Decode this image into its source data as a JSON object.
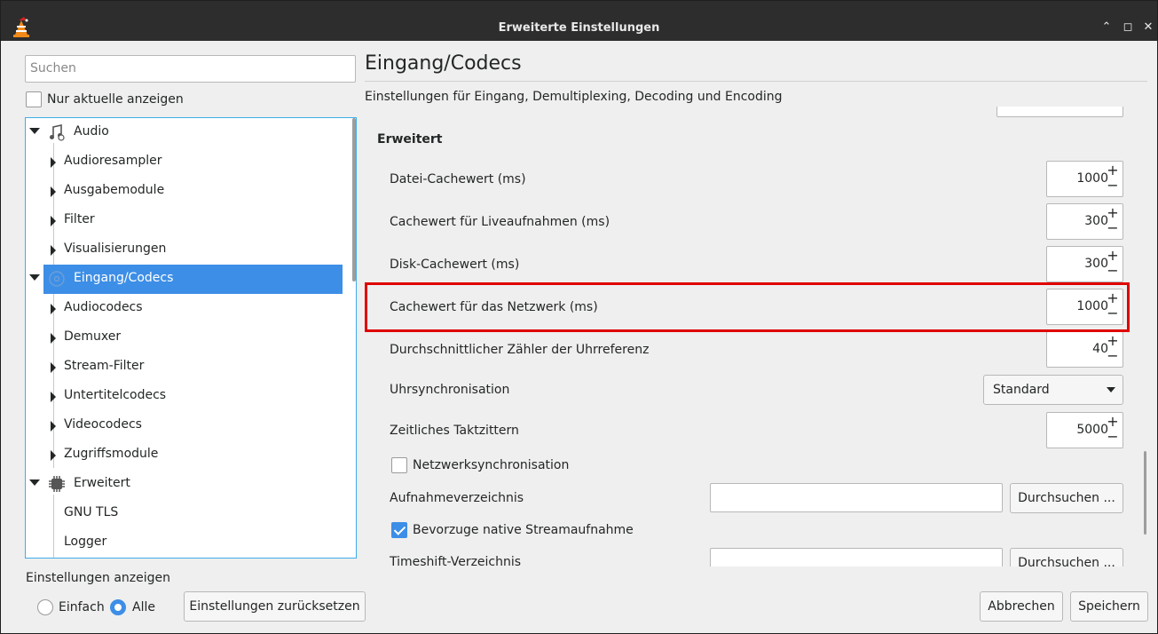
{
  "window": {
    "title": "Erweiterte Einstellungen"
  },
  "left": {
    "search_placeholder": "Suchen",
    "only_current_label": "Nur aktuelle anzeigen",
    "tree": [
      {
        "label": "Audio",
        "level": 0,
        "expanded": true,
        "icon": "music-settings-icon"
      },
      {
        "label": "Audioresampler",
        "level": 1
      },
      {
        "label": "Ausgabemodule",
        "level": 1
      },
      {
        "label": "Filter",
        "level": 1
      },
      {
        "label": "Visualisierungen",
        "level": 1
      },
      {
        "label": "Eingang/Codecs",
        "level": 0,
        "expanded": true,
        "selected": true,
        "icon": "disc-icon"
      },
      {
        "label": "Audiocodecs",
        "level": 1
      },
      {
        "label": "Demuxer",
        "level": 1
      },
      {
        "label": "Stream-Filter",
        "level": 1
      },
      {
        "label": "Untertitelcodecs",
        "level": 1
      },
      {
        "label": "Videocodecs",
        "level": 1
      },
      {
        "label": "Zugriffsmodule",
        "level": 1
      },
      {
        "label": "Erweitert",
        "level": 0,
        "expanded": true,
        "icon": "chip-icon"
      },
      {
        "label": "GNU TLS",
        "level": 1,
        "leaf": true
      },
      {
        "label": "Logger",
        "level": 1,
        "leaf": true
      }
    ]
  },
  "right": {
    "title": "Eingang/Codecs",
    "subtitle": "Einstellungen für Eingang, Demultiplexing, Decoding und Encoding",
    "section": "Erweitert",
    "file_cache_label": "Datei-Cachewert (ms)",
    "file_cache_value": "1000",
    "live_cache_label": "Cachewert für Liveaufnahmen (ms)",
    "live_cache_value": "300",
    "disc_cache_label": "Disk-Cachewert (ms)",
    "disc_cache_value": "300",
    "network_cache_label": "Cachewert für das Netzwerk (ms)",
    "network_cache_value": "1000",
    "clock_ref_label": "Durchschnittlicher Zähler der Uhrreferenz",
    "clock_ref_value": "40",
    "clock_sync_label": "Uhrsynchronisation",
    "clock_sync_value": "Standard",
    "clock_jitter_label": "Zeitliches Taktzittern",
    "clock_jitter_value": "5000",
    "network_sync_label": "Netzwerksynchronisation",
    "record_dir_label": "Aufnahmeverzeichnis",
    "browse_label": "Durchsuchen ...",
    "native_record_label": "Bevorzuge native Streamaufnahme",
    "timeshift_label": "Timeshift-Verzeichnis",
    "browse_label_2": "Durchsuchen ..."
  },
  "bottom": {
    "show_settings_label": "Einstellungen anzeigen",
    "simple_label": "Einfach",
    "all_label": "Alle",
    "reset_label": "Einstellungen zurücksetzen",
    "cancel_label": "Abbrechen",
    "save_label": "Speichern"
  },
  "colors": {
    "accent": "#3d8ee6",
    "highlight": "#e00000"
  }
}
